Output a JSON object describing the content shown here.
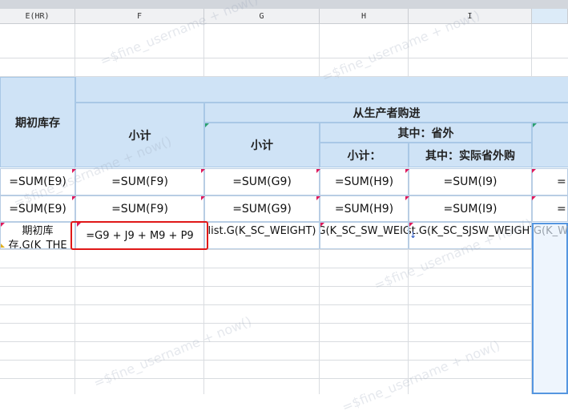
{
  "columns": [
    "E(HR)",
    "F",
    "G",
    "H",
    "I"
  ],
  "header": {
    "opening_stock": "期初库存",
    "purchase_from_producers": "从生产者购进",
    "subtotal_f": "小计",
    "subtotal_g": "小计",
    "of_which_out_of_province": "其中：省外",
    "subtotal_h": "小计：",
    "of_which_actual_out_of_province": "其中：实际省外购"
  },
  "row9": [
    "=SUM(E9)",
    "=SUM(F9)",
    "=SUM(G9)",
    "=SUM(H9)",
    "=SUM(I9)",
    "="
  ],
  "row10": [
    "=SUM(E9)",
    "=SUM(F9)",
    "=SUM(G9)",
    "=SUM(H9)",
    "=SUM(I9)",
    "="
  ],
  "row11": [
    "期初库存.G(K_THE",
    "=G9 + J9 + M9 + P9",
    "list.G(K_SC_WEIGHT)",
    "list.G(K_SC_SW_WEIGHT)",
    "list.G(K_SC_SJSW_WEIGHT)",
    "list.G(K_W"
  ],
  "watermark": "=$fine_username + now()"
}
